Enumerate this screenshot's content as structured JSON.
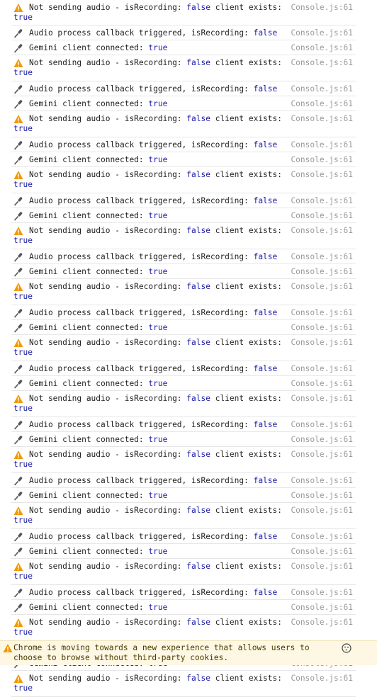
{
  "entries": [
    {
      "kind": "warn",
      "first": true,
      "prefix": "Not sending audio - isRecording: ",
      "v1": "false",
      "mid": " client exists:",
      "v2": "true",
      "source": "Console.js:61"
    },
    {
      "kind": "audio",
      "prefix": "Audio process callback triggered, isRecording: ",
      "v1": "false",
      "source": "Console.js:61"
    },
    {
      "kind": "gemini",
      "prefix": "Gemini client connected: ",
      "v1": "true",
      "source": "Console.js:61"
    },
    {
      "kind": "warn",
      "prefix": "Not sending audio - isRecording: ",
      "v1": "false",
      "mid": " client exists:",
      "v2": "true",
      "source": "Console.js:61"
    },
    {
      "kind": "audio",
      "prefix": "Audio process callback triggered, isRecording: ",
      "v1": "false",
      "source": "Console.js:61"
    },
    {
      "kind": "gemini",
      "prefix": "Gemini client connected: ",
      "v1": "true",
      "source": "Console.js:61"
    },
    {
      "kind": "warn",
      "prefix": "Not sending audio - isRecording: ",
      "v1": "false",
      "mid": " client exists:",
      "v2": "true",
      "source": "Console.js:61"
    },
    {
      "kind": "audio",
      "prefix": "Audio process callback triggered, isRecording: ",
      "v1": "false",
      "source": "Console.js:61"
    },
    {
      "kind": "gemini",
      "prefix": "Gemini client connected: ",
      "v1": "true",
      "source": "Console.js:61"
    },
    {
      "kind": "warn",
      "prefix": "Not sending audio - isRecording: ",
      "v1": "false",
      "mid": " client exists:",
      "v2": "true",
      "source": "Console.js:61"
    },
    {
      "kind": "audio",
      "prefix": "Audio process callback triggered, isRecording: ",
      "v1": "false",
      "source": "Console.js:61"
    },
    {
      "kind": "gemini",
      "prefix": "Gemini client connected: ",
      "v1": "true",
      "source": "Console.js:61"
    },
    {
      "kind": "warn",
      "prefix": "Not sending audio - isRecording: ",
      "v1": "false",
      "mid": " client exists:",
      "v2": "true",
      "source": "Console.js:61"
    },
    {
      "kind": "audio",
      "prefix": "Audio process callback triggered, isRecording: ",
      "v1": "false",
      "source": "Console.js:61"
    },
    {
      "kind": "gemini",
      "prefix": "Gemini client connected: ",
      "v1": "true",
      "source": "Console.js:61"
    },
    {
      "kind": "warn",
      "prefix": "Not sending audio - isRecording: ",
      "v1": "false",
      "mid": " client exists:",
      "v2": "true",
      "source": "Console.js:61"
    },
    {
      "kind": "audio",
      "prefix": "Audio process callback triggered, isRecording: ",
      "v1": "false",
      "source": "Console.js:61"
    },
    {
      "kind": "gemini",
      "prefix": "Gemini client connected: ",
      "v1": "true",
      "source": "Console.js:61"
    },
    {
      "kind": "warn",
      "prefix": "Not sending audio - isRecording: ",
      "v1": "false",
      "mid": " client exists:",
      "v2": "true",
      "source": "Console.js:61"
    },
    {
      "kind": "audio",
      "prefix": "Audio process callback triggered, isRecording: ",
      "v1": "false",
      "source": "Console.js:61"
    },
    {
      "kind": "gemini",
      "prefix": "Gemini client connected: ",
      "v1": "true",
      "source": "Console.js:61"
    },
    {
      "kind": "warn",
      "prefix": "Not sending audio - isRecording: ",
      "v1": "false",
      "mid": " client exists:",
      "v2": "true",
      "source": "Console.js:61"
    },
    {
      "kind": "audio",
      "prefix": "Audio process callback triggered, isRecording: ",
      "v1": "false",
      "source": "Console.js:61"
    },
    {
      "kind": "gemini",
      "prefix": "Gemini client connected: ",
      "v1": "true",
      "source": "Console.js:61"
    },
    {
      "kind": "warn",
      "prefix": "Not sending audio - isRecording: ",
      "v1": "false",
      "mid": " client exists:",
      "v2": "true",
      "source": "Console.js:61"
    },
    {
      "kind": "audio",
      "prefix": "Audio process callback triggered, isRecording: ",
      "v1": "false",
      "source": "Console.js:61"
    },
    {
      "kind": "gemini",
      "prefix": "Gemini client connected: ",
      "v1": "true",
      "source": "Console.js:61"
    },
    {
      "kind": "warn",
      "prefix": "Not sending audio - isRecording: ",
      "v1": "false",
      "mid": " client exists:",
      "v2": "true",
      "source": "Console.js:61"
    },
    {
      "kind": "audio",
      "prefix": "Audio process callback triggered, isRecording: ",
      "v1": "false",
      "source": "Console.js:61"
    },
    {
      "kind": "gemini",
      "prefix": "Gemini client connected: ",
      "v1": "true",
      "source": "Console.js:61"
    },
    {
      "kind": "warn",
      "prefix": "Not sending audio - isRecording: ",
      "v1": "false",
      "mid": " client exists:",
      "v2": "true",
      "source": "Console.js:61"
    },
    {
      "kind": "audio",
      "prefix": "Audio process callback triggered, isRecording: ",
      "v1": "false",
      "source": "Console.js:61"
    },
    {
      "kind": "gemini",
      "prefix": "Gemini client connected: ",
      "v1": "true",
      "source": "Console.js:61"
    },
    {
      "kind": "warn",
      "prefix": "Not sending audio - isRecording: ",
      "v1": "false",
      "mid": " client exists:",
      "v2": "true",
      "source": "Console.js:61"
    },
    {
      "kind": "audio",
      "prefix": "Audio process callback triggered, isRecording: ",
      "v1": "false",
      "source": "Console.js:61"
    },
    {
      "kind": "gemini",
      "prefix": "Gemini client connected: ",
      "v1": "true",
      "source": "Console.js:61"
    },
    {
      "kind": "warn",
      "prefix": "Not sending audio - isRecording: ",
      "v1": "false",
      "mid": " client exists:",
      "v2": "true",
      "source": "Console.js:61"
    }
  ],
  "banner": {
    "text": "Chrome is moving towards a new experience that allows users to choose to browse without third-party cookies.",
    "icon": "warning-icon",
    "action_icon": "cookie-icon"
  },
  "colors": {
    "value_keyword": "#1a1aa6",
    "source_link": "#9a9a9a",
    "warning_icon": "#f29900",
    "banner_bg": "#fdf7e3"
  }
}
